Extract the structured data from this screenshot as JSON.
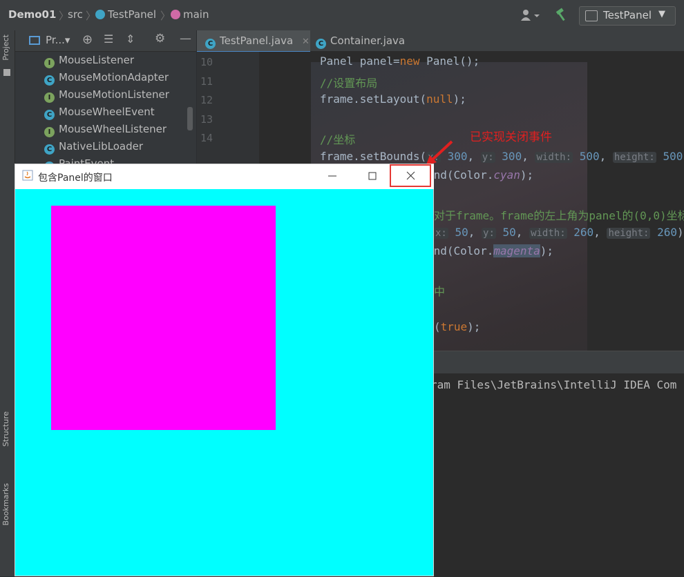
{
  "breadcrumb": {
    "project": "Demo01",
    "folder": "src",
    "class": "TestPanel",
    "method": "main"
  },
  "run_config": "TestPanel",
  "left_stripe": {
    "project_label": "Project",
    "structure_label": "Structure",
    "bookmarks_label": "Bookmarks"
  },
  "project_panel": {
    "title": "Pr...",
    "items": [
      {
        "kind": "I",
        "label": "MouseListener"
      },
      {
        "kind": "C",
        "label": "MouseMotionAdapter"
      },
      {
        "kind": "I",
        "label": "MouseMotionListener"
      },
      {
        "kind": "C",
        "label": "MouseWheelEvent"
      },
      {
        "kind": "I",
        "label": "MouseWheelListener"
      },
      {
        "kind": "C",
        "label": "NativeLibLoader"
      },
      {
        "kind": "C",
        "label": "PaintEvent"
      }
    ]
  },
  "editor": {
    "tabs": [
      {
        "label": "TestPanel.java",
        "active": true
      },
      {
        "label": "Container.java",
        "active": false
      }
    ],
    "line_numbers": [
      "10",
      "11",
      "12",
      "13",
      "14"
    ],
    "console_text": "ram Files\\JetBrains\\IntelliJ IDEA Com"
  },
  "annotation": {
    "text": "已实现关闭事件",
    "color": "#e02020"
  },
  "java_window": {
    "title": "包含Panel的窗口",
    "background": "#00ffff",
    "panel_color": "#ff00ff",
    "min_icon": "minimize-icon",
    "max_icon": "maximize-icon",
    "close_icon": "close-icon"
  }
}
